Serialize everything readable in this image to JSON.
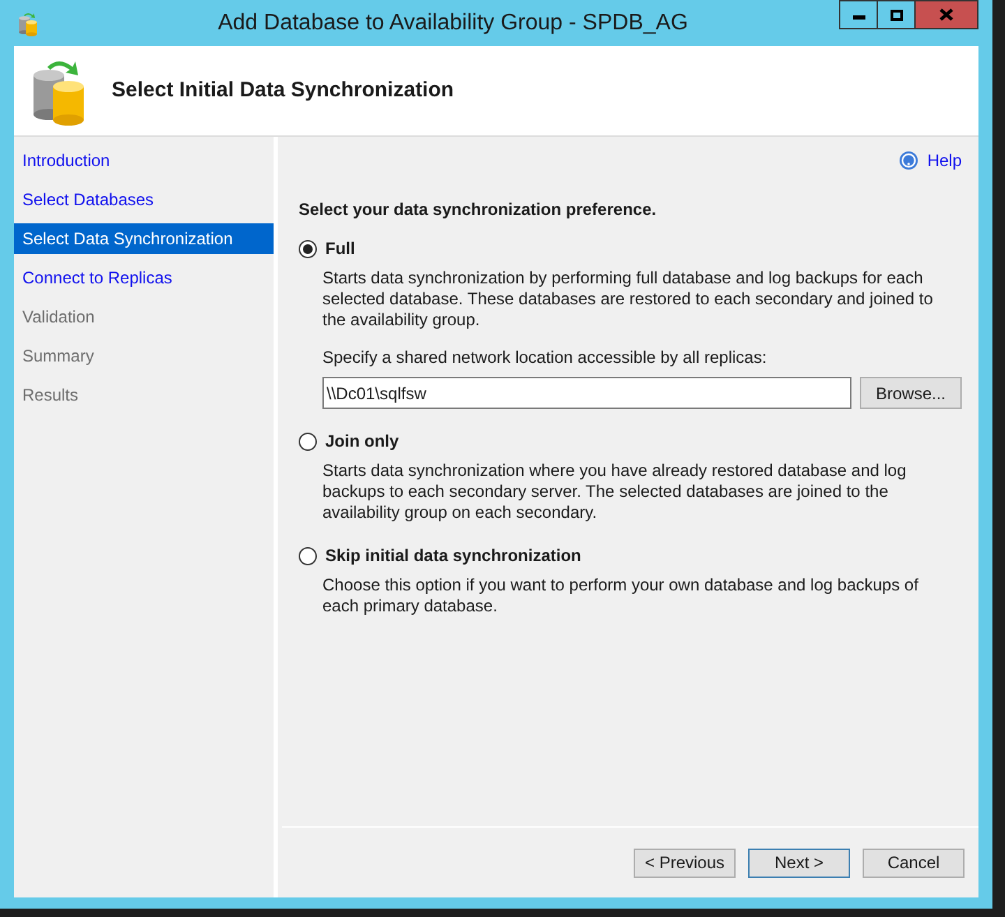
{
  "window": {
    "title": "Add Database to Availability Group - SPDB_AG"
  },
  "header": {
    "title": "Select Initial Data Synchronization"
  },
  "sidebar": {
    "items": [
      {
        "label": "Introduction",
        "selected": false,
        "disabled": false
      },
      {
        "label": "Select Databases",
        "selected": false,
        "disabled": false
      },
      {
        "label": "Select Data Synchronization",
        "selected": true,
        "disabled": false
      },
      {
        "label": "Connect to Replicas",
        "selected": false,
        "disabled": false
      },
      {
        "label": "Validation",
        "selected": false,
        "disabled": true
      },
      {
        "label": "Summary",
        "selected": false,
        "disabled": true
      },
      {
        "label": "Results",
        "selected": false,
        "disabled": true
      }
    ]
  },
  "help": {
    "label": "Help"
  },
  "prompt": "Select your data synchronization preference.",
  "options": [
    {
      "label": "Full",
      "selected": true,
      "description": "Starts data synchronization by performing full database and log backups for each selected database. These databases are restored to each secondary and joined to the availability group.",
      "location": {
        "label": "Specify a shared network location accessible by all replicas:",
        "value": "\\\\Dc01\\sqlfsw",
        "button": "Browse..."
      }
    },
    {
      "label": "Join only",
      "selected": false,
      "description": "Starts data synchronization where you have already restored database and log backups to each secondary server. The selected databases are joined to the availability group on each secondary."
    },
    {
      "label": "Skip initial data synchronization",
      "selected": false,
      "description": "Choose this option if you want to perform your own database and log backups of each primary database."
    }
  ],
  "buttons": [
    {
      "label": "< Previous",
      "default": false
    },
    {
      "label": "Next >",
      "default": true
    },
    {
      "label": "Cancel",
      "default": false
    }
  ]
}
